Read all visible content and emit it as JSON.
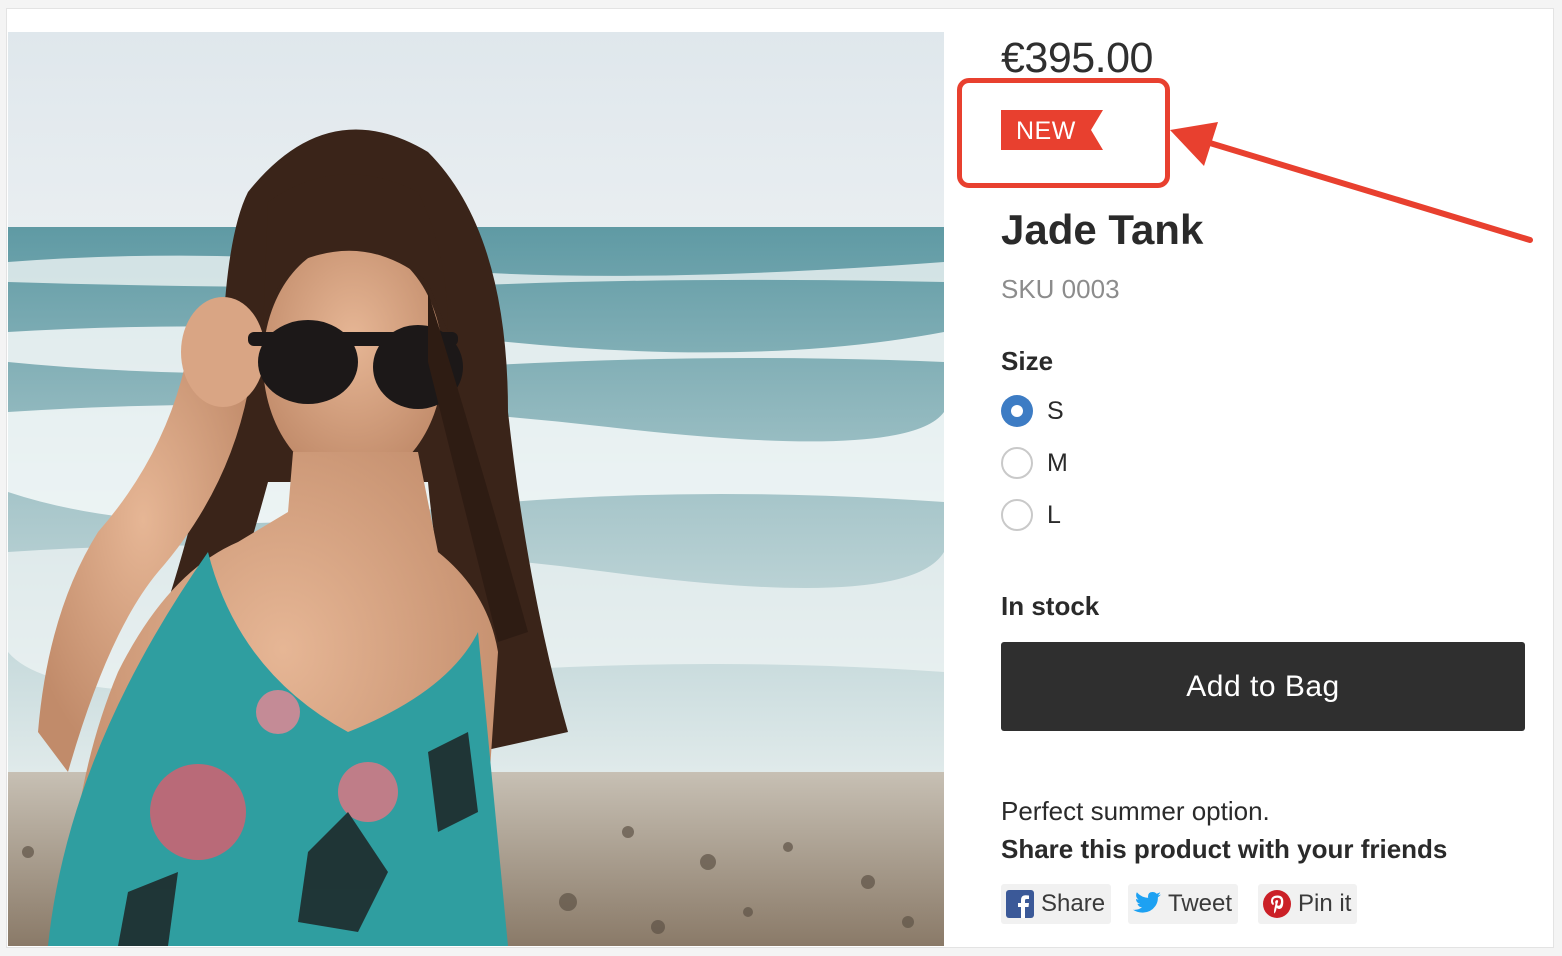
{
  "product": {
    "price": "€395.00",
    "badge": "NEW",
    "title": "Jade Tank",
    "sku": "SKU 0003",
    "description": "Perfect summer option.",
    "stock_status": "In stock"
  },
  "size": {
    "label": "Size",
    "options": [
      {
        "label": "S",
        "selected": true
      },
      {
        "label": "M",
        "selected": false
      },
      {
        "label": "L",
        "selected": false
      }
    ]
  },
  "actions": {
    "add_to_bag": "Add to Bag"
  },
  "share": {
    "heading": "Share this product with your friends",
    "buttons": [
      {
        "label": "Share",
        "icon": "facebook-icon"
      },
      {
        "label": "Tweet",
        "icon": "twitter-icon"
      },
      {
        "label": "Pin it",
        "icon": "pinterest-icon"
      }
    ]
  },
  "colors": {
    "badge": "#e8402f",
    "annotation": "#e8402f",
    "button": "#2f2f2f",
    "radio_selected": "#3d7cc4",
    "facebook": "#3b5998",
    "twitter": "#1da1f2",
    "pinterest": "#cb2027"
  }
}
